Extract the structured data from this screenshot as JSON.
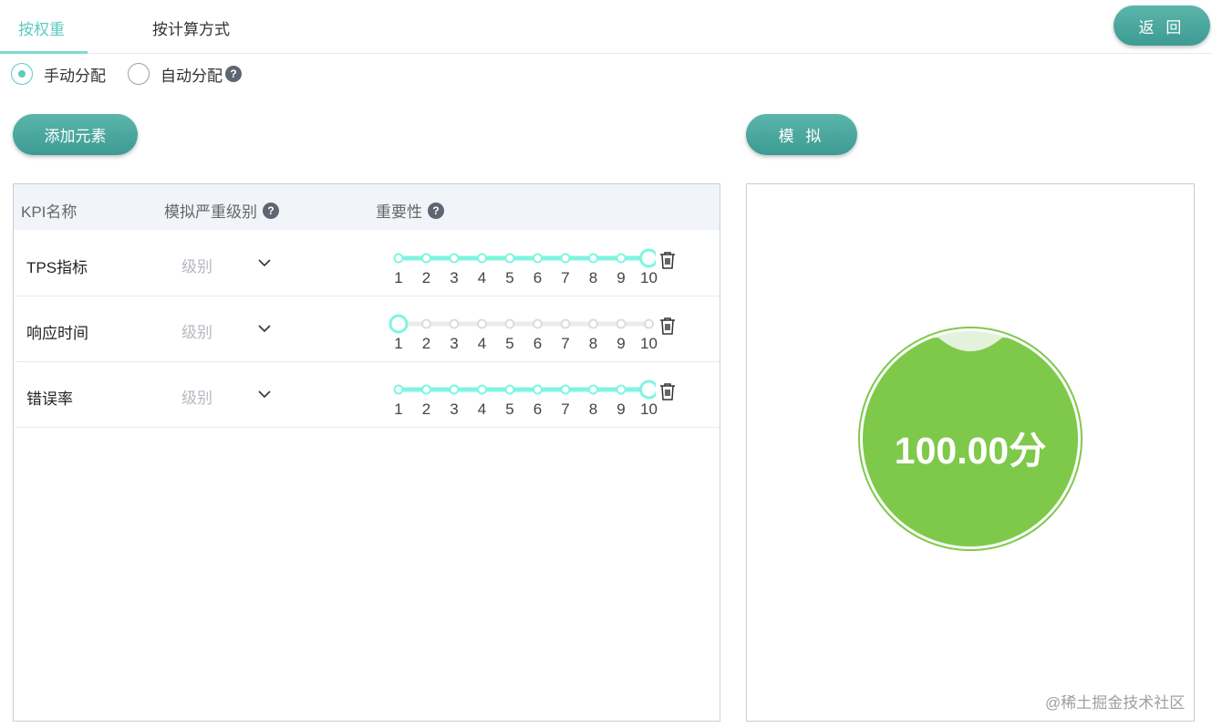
{
  "tabs": [
    {
      "label": "按权重",
      "active": true
    },
    {
      "label": "按计算方式",
      "active": false
    }
  ],
  "back_label": "返 回",
  "radios": [
    {
      "label": "手动分配",
      "checked": true
    },
    {
      "label": "自动分配",
      "checked": false,
      "help": true
    }
  ],
  "help_glyph": "?",
  "add_label": "添加元素",
  "simulate_label": "模 拟",
  "table": {
    "headers": {
      "name": "KPI名称",
      "level": "模拟严重级别",
      "importance": "重要性"
    },
    "rows": [
      {
        "name": "TPS指标",
        "level_placeholder": "级别",
        "value": 10
      },
      {
        "name": "响应时间",
        "level_placeholder": "级别",
        "value": 1
      },
      {
        "name": "错误率",
        "level_placeholder": "级别",
        "value": 10
      }
    ],
    "scale": [
      "1",
      "2",
      "3",
      "4",
      "5",
      "6",
      "7",
      "8",
      "9",
      "10"
    ]
  },
  "score": {
    "text": "100.00分",
    "fill": 0.97
  },
  "colors": {
    "accent": "#5ec9c2",
    "slider_active": "#7ff5e1",
    "slider_inactive": "#ebebeb",
    "score_green": "#7ec94a",
    "button": "#45a59d"
  },
  "watermark": "@稀土掘金技术社区"
}
